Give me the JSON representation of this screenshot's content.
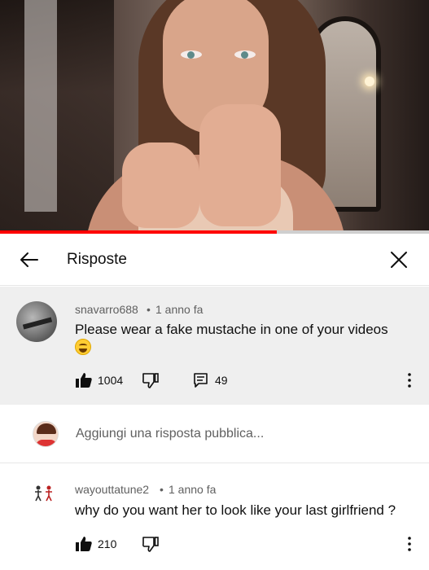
{
  "header": {
    "title": "Risposte"
  },
  "video": {
    "progress_fraction": 0.645
  },
  "comments": [
    {
      "username": "snavarro688",
      "separator": "•",
      "age": "1 anno fa",
      "text": "Please wear a fake mustache in one of your videos",
      "emoji": "laughing-face-emoji",
      "likes": "1004",
      "replies": "49"
    },
    {
      "username": "wayouttatune2",
      "separator": "•",
      "age": "1 anno fa",
      "text": "why do you want her to look like your last girlfriend ?",
      "likes": "210"
    }
  ],
  "reply_input": {
    "placeholder": "Aggiungi una risposta pubblica..."
  },
  "colors": {
    "progress": "#ff0000",
    "highlight_bg": "#efefef",
    "meta_text": "#606060"
  }
}
